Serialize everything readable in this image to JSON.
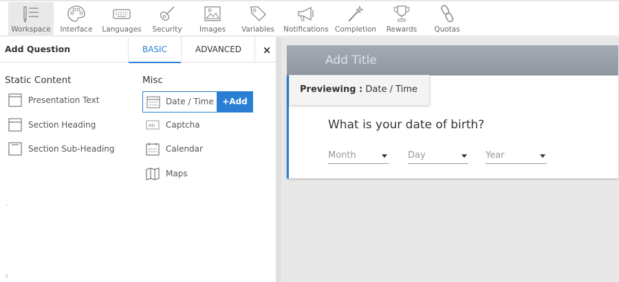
{
  "toolbar": {
    "items": [
      {
        "label": "Workspace",
        "icon": "workspace-icon",
        "active": true
      },
      {
        "label": "Interface",
        "icon": "palette-icon"
      },
      {
        "label": "Languages",
        "icon": "keyboard-icon"
      },
      {
        "label": "Security",
        "icon": "guitar-icon"
      },
      {
        "label": "Images",
        "icon": "image-icon"
      },
      {
        "label": "Variables",
        "icon": "tag-icon"
      },
      {
        "label": "Notifications",
        "icon": "megaphone-icon"
      },
      {
        "label": "Completion",
        "icon": "magic-wand-icon"
      },
      {
        "label": "Rewards",
        "icon": "trophy-icon"
      },
      {
        "label": "Quotas",
        "icon": "chain-icon"
      }
    ]
  },
  "panel": {
    "title": "Add Question",
    "tabs": {
      "basic": "BASIC",
      "advanced": "ADVANCED"
    },
    "close": "×",
    "static": {
      "title": "Static Content",
      "items": [
        {
          "label": "Presentation Text",
          "icon": "presentation-text-icon"
        },
        {
          "label": "Section Heading",
          "icon": "section-heading-icon"
        },
        {
          "label": "Section Sub-Heading",
          "icon": "section-subheading-icon"
        }
      ]
    },
    "misc": {
      "title": "Misc",
      "items": [
        {
          "label": "Date / Time",
          "icon": "date-time-icon"
        },
        {
          "label": "Captcha",
          "icon": "captcha-icon"
        },
        {
          "label": "Calendar",
          "icon": "calendar-icon"
        },
        {
          "label": "Maps",
          "icon": "map-icon"
        }
      ],
      "add_label": "+Add"
    },
    "stray_marks": [
      ",",
      "c"
    ]
  },
  "preview": {
    "title_placeholder": "Add Title",
    "previewing_label": "Previewing :",
    "previewing_value": "Date / Time",
    "question": "What is your date of birth?",
    "selects": [
      {
        "placeholder": "Month"
      },
      {
        "placeholder": "Day"
      },
      {
        "placeholder": "Year"
      }
    ]
  },
  "colors": {
    "accent": "#2a7fd4",
    "title_bar": "#9aa1aa"
  }
}
